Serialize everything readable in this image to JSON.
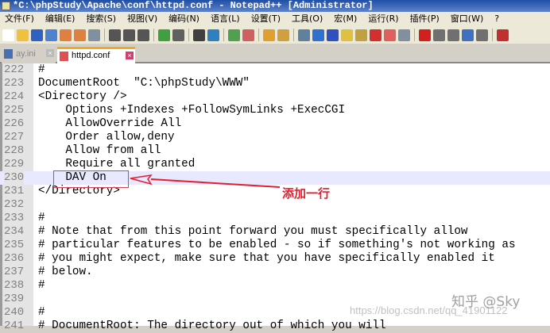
{
  "window": {
    "title": "*C:\\phpStudy\\Apache\\conf\\httpd.conf - Notepad++ [Administrator]"
  },
  "menu": [
    "文件(F)",
    "编辑(E)",
    "搜索(S)",
    "视图(V)",
    "编码(N)",
    "语言(L)",
    "设置(T)",
    "工具(O)",
    "宏(M)",
    "运行(R)",
    "插件(P)",
    "窗口(W)",
    "?"
  ],
  "toolbar_icons": [
    "new",
    "open",
    "save",
    "save-all",
    "close",
    "close-all",
    "print",
    "cut",
    "copy",
    "paste",
    "undo",
    "redo",
    "find",
    "replace",
    "zoom-in",
    "zoom-out",
    "sync-v",
    "sync-h",
    "wrap",
    "all-chars",
    "indent-guide",
    "udl",
    "doc-map",
    "pdf",
    "folder",
    "monitor",
    "record",
    "stop",
    "play",
    "play-multi",
    "save-macro",
    "spellcheck"
  ],
  "tabs": [
    {
      "label": "ay.ini",
      "active": false
    },
    {
      "label": "httpd.conf",
      "active": true
    }
  ],
  "lines": [
    {
      "no": "222",
      "text": "#"
    },
    {
      "no": "223",
      "text": "DocumentRoot  \"C:\\phpStudy\\WWW\""
    },
    {
      "no": "224",
      "text": "<Directory />"
    },
    {
      "no": "225",
      "text": "    Options +Indexes +FollowSymLinks +ExecCGI"
    },
    {
      "no": "226",
      "text": "    AllowOverride All"
    },
    {
      "no": "227",
      "text": "    Order allow,deny"
    },
    {
      "no": "228",
      "text": "    Allow from all"
    },
    {
      "no": "229",
      "text": "    Require all granted"
    },
    {
      "no": "230",
      "text": "    DAV On"
    },
    {
      "no": "231",
      "text": "</Directory>"
    },
    {
      "no": "232",
      "text": ""
    },
    {
      "no": "233",
      "text": "#"
    },
    {
      "no": "234",
      "text": "# Note that from this point forward you must specifically allow"
    },
    {
      "no": "235",
      "text": "# particular features to be enabled - so if something's not working as"
    },
    {
      "no": "236",
      "text": "# you might expect, make sure that you have specifically enabled it"
    },
    {
      "no": "237",
      "text": "# below."
    },
    {
      "no": "238",
      "text": "#"
    },
    {
      "no": "239",
      "text": ""
    },
    {
      "no": "240",
      "text": "#"
    },
    {
      "no": "241",
      "text": "# DocumentRoot: The directory out of which you will"
    }
  ],
  "current_line": "230",
  "annotation": "添加一行",
  "watermark": {
    "brand": "知乎 @Sky",
    "url": "https://blog.csdn.net/qq_41901122"
  },
  "colors": {
    "annotation": "#e02030",
    "current_line_bg": "#e8e8ff"
  }
}
